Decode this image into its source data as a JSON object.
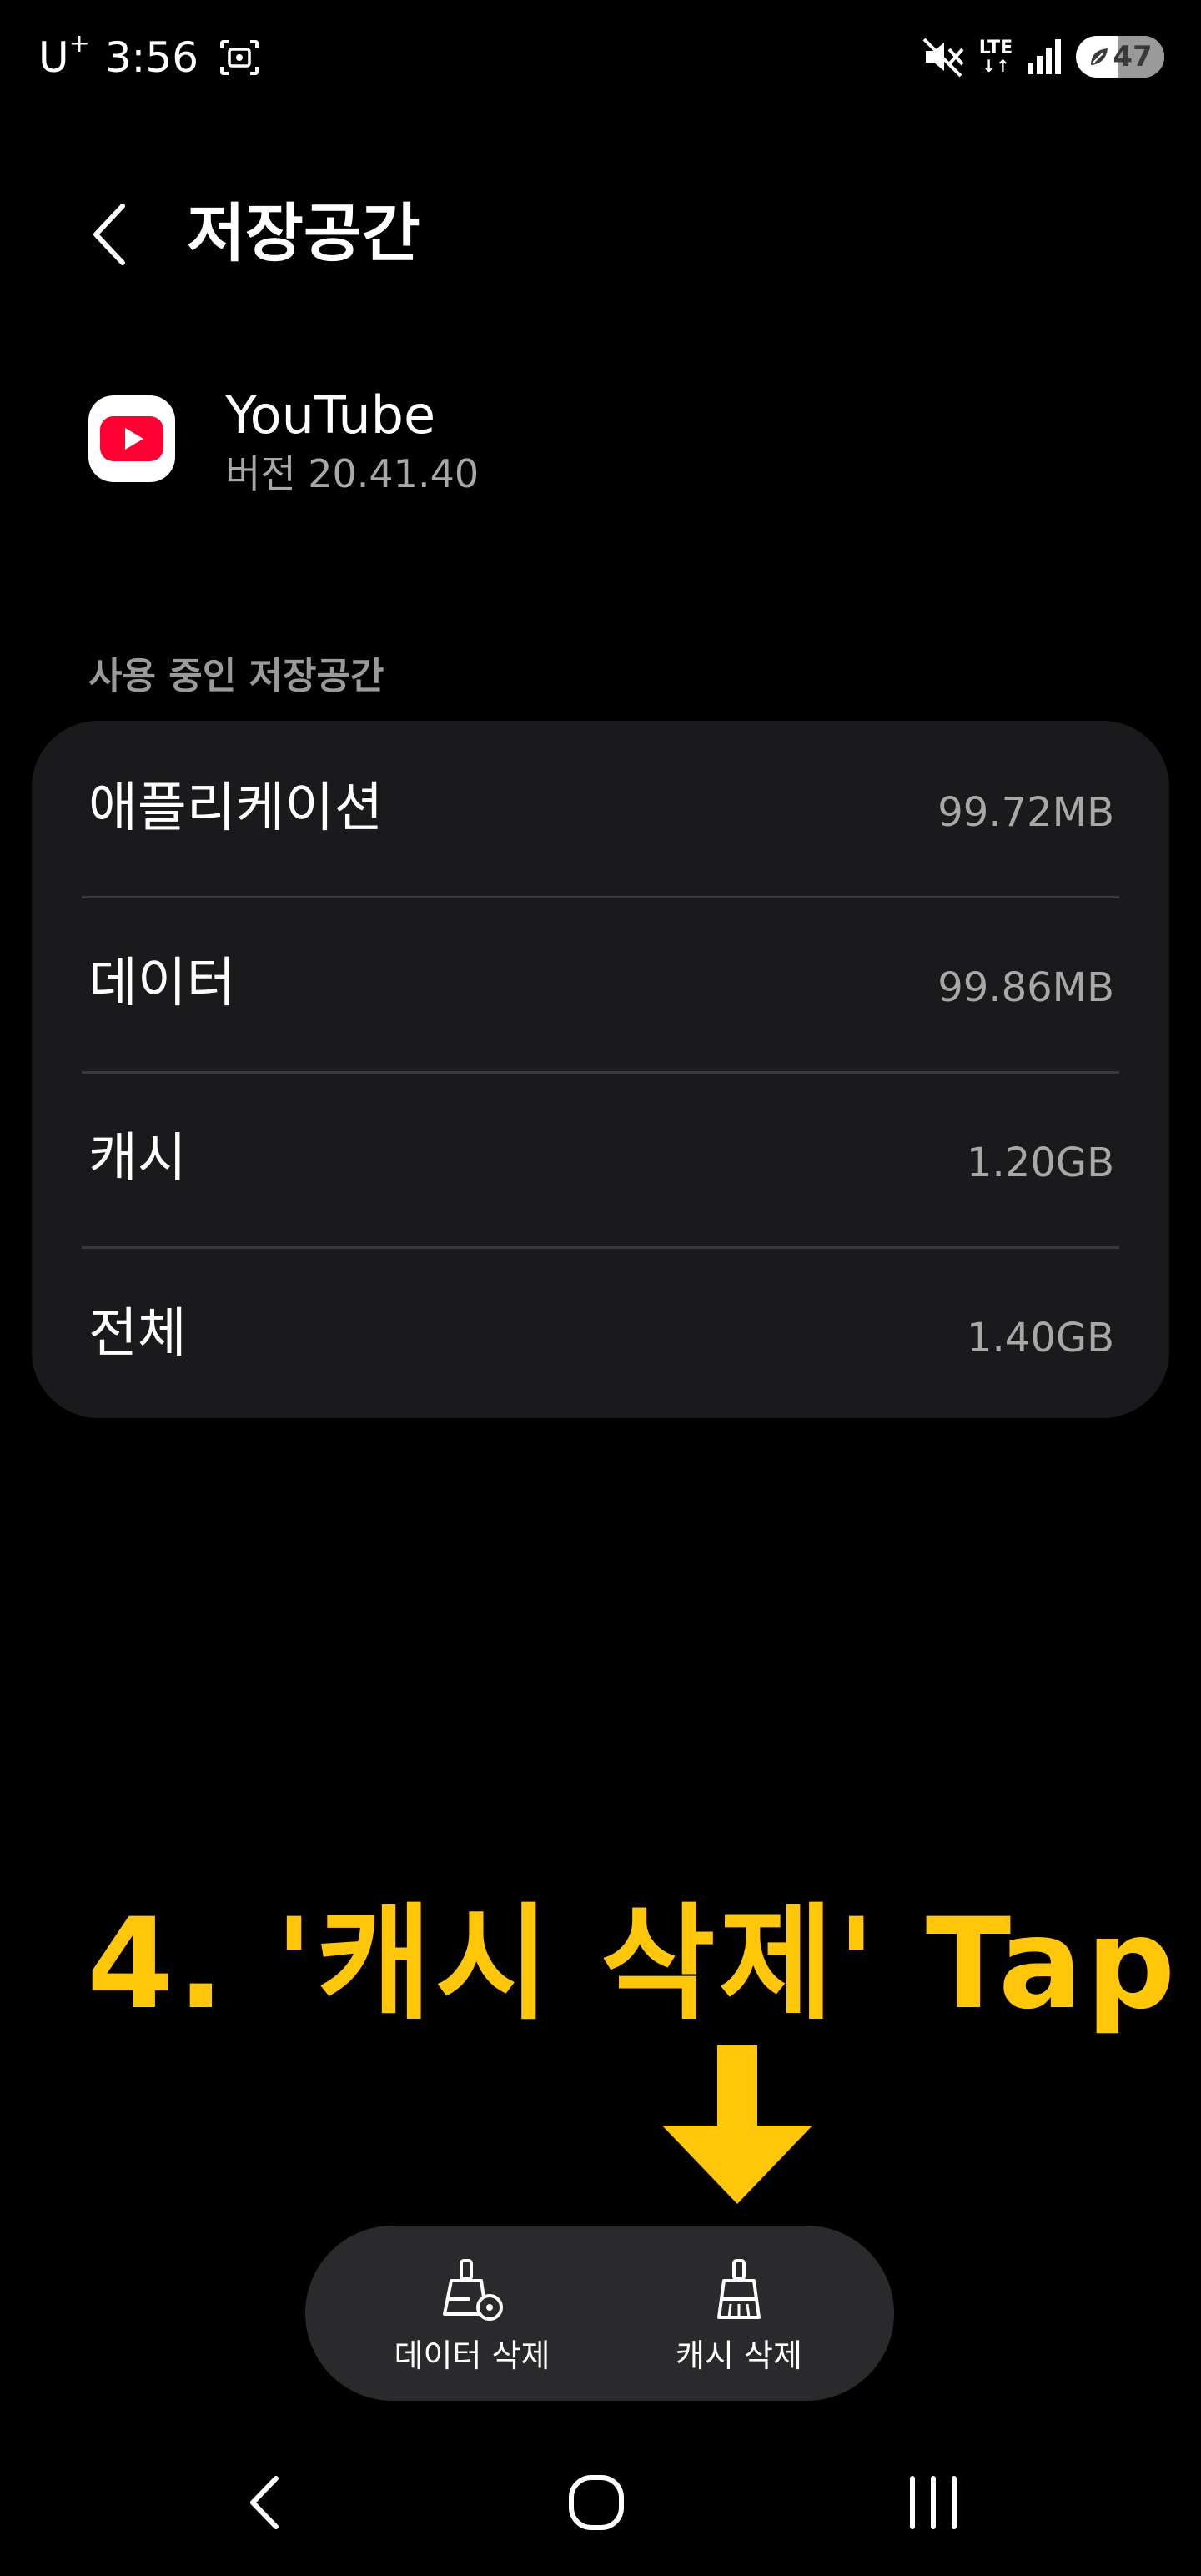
{
  "status_bar": {
    "carrier": "U",
    "carrier_sup": "+",
    "time": "3:56",
    "network": "LTE",
    "battery": "47",
    "battery_level": 0.47
  },
  "header": {
    "title": "저장공간"
  },
  "app": {
    "name": "YouTube",
    "version": "버전 20.41.40",
    "icon": "youtube-icon",
    "brand_color": "#ff0033"
  },
  "section": {
    "label": "사용 중인 저장공간"
  },
  "storage": {
    "rows": [
      {
        "label": "애플리케이션",
        "value": "99.72MB"
      },
      {
        "label": "데이터",
        "value": "99.86MB"
      },
      {
        "label": "캐시",
        "value": "1.20GB"
      },
      {
        "label": "전체",
        "value": "1.40GB"
      }
    ]
  },
  "instruction": {
    "text": "4. '캐시 삭제' Tap",
    "color": "#ffc60a"
  },
  "actions": {
    "clear_data_label": "데이터 삭제",
    "clear_cache_label": "캐시 삭제"
  },
  "nav": {
    "back_icon": "back-icon",
    "home_icon": "home-icon",
    "recents_icon": "recents-icon"
  }
}
